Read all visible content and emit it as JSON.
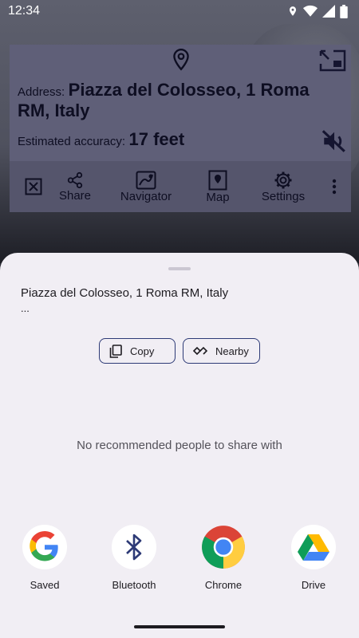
{
  "status_bar": {
    "time": "12:34"
  },
  "app": {
    "address_label": "Address:",
    "address_value": "Piazza del Colosseo, 1 Roma RM, Italy",
    "accuracy_label": "Estimated accuracy:",
    "accuracy_value": "17 feet",
    "toolbar": [
      {
        "label": "",
        "icon": "close-box-icon"
      },
      {
        "label": "Share",
        "icon": "share-icon"
      },
      {
        "label": "Navigator",
        "icon": "navigator-icon"
      },
      {
        "label": "Map",
        "icon": "map-icon"
      },
      {
        "label": "Settings",
        "icon": "gear-icon"
      }
    ]
  },
  "share_sheet": {
    "text": "Piazza del Colosseo, 1 Roma RM, Italy",
    "ellipsis": "...",
    "copy_label": "Copy",
    "nearby_label": "Nearby",
    "empty_message": "No recommended people to share with",
    "apps": [
      {
        "label": "Saved",
        "icon": "google-icon"
      },
      {
        "label": "Bluetooth",
        "icon": "bluetooth-icon"
      },
      {
        "label": "Chrome",
        "icon": "chrome-icon"
      },
      {
        "label": "Drive",
        "icon": "drive-icon"
      }
    ]
  },
  "colors": {
    "sheet_bg": "#f1eef4",
    "chip_border": "#2d3a76",
    "overlay": "#5f5f78"
  }
}
